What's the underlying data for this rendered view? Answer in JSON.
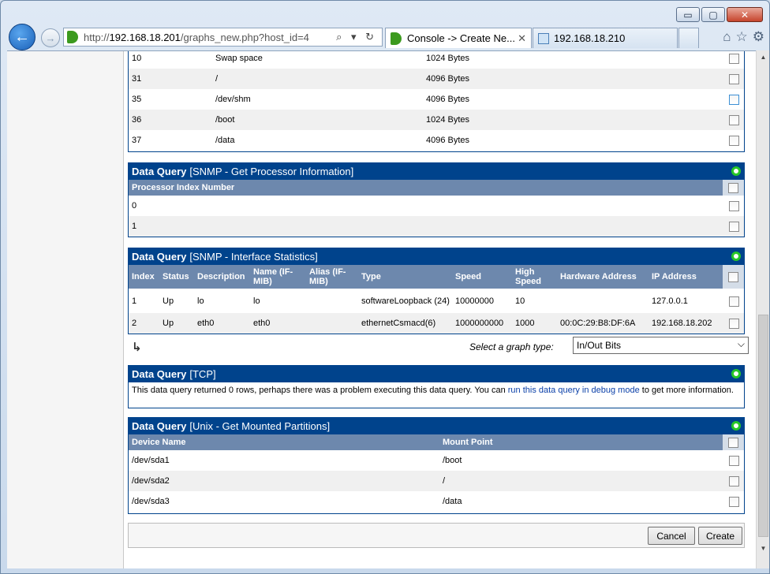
{
  "browser": {
    "url_prefix": "http://",
    "url_host": "192.168.18.201",
    "url_path": "/graphs_new.php?host_id=4",
    "addr_icons": "⌕ ▾ ↻",
    "tabs": [
      {
        "label": "Console -> Create Ne...",
        "close": "✕"
      },
      {
        "label": "192.168.18.210"
      }
    ],
    "controls": {
      "minimize": "▭",
      "maximize": "▢",
      "close": "✕"
    },
    "tool_icons": {
      "home": "⌂",
      "favorites": "☆",
      "settings": "⚙"
    }
  },
  "top_rows": [
    {
      "index": "10",
      "name": "Swap space",
      "size": "1024 Bytes"
    },
    {
      "index": "31",
      "name": "/",
      "size": "4096 Bytes"
    },
    {
      "index": "35",
      "name": "/dev/shm",
      "size": "4096 Bytes"
    },
    {
      "index": "36",
      "name": "/boot",
      "size": "1024 Bytes"
    },
    {
      "index": "37",
      "name": "/data",
      "size": "4096 Bytes"
    }
  ],
  "processor": {
    "title_bold": "Data Query",
    "title": "[SNMP - Get Processor Information]",
    "column": "Processor Index Number",
    "rows": [
      "0",
      "1"
    ]
  },
  "interfaces": {
    "title_bold": "Data Query",
    "title": "[SNMP - Interface Statistics]",
    "columns": {
      "index": "Index",
      "status": "Status",
      "description": "Description",
      "name": "Name (IF-MIB)",
      "alias": "Alias (IF-MIB)",
      "type": "Type",
      "speed": "Speed",
      "high_speed": "High Speed",
      "hardware": "Hardware Address",
      "ip": "IP Address"
    },
    "rows": [
      {
        "index": "1",
        "status": "Up",
        "description": "lo",
        "name": "lo",
        "type": "softwareLoopback (24)",
        "speed": "10000000",
        "high_speed": "10",
        "hardware": "",
        "ip": "127.0.0.1"
      },
      {
        "index": "2",
        "status": "Up",
        "description": "eth0",
        "name": "eth0",
        "type": "ethernetCsmacd(6)",
        "speed": "1000000000",
        "high_speed": "1000",
        "hardware": "00:0C:29:B8:DF:6A",
        "ip": "192.168.18.202"
      }
    ],
    "graph_type_label": "Select a graph type:",
    "graph_type_value": "In/Out Bits",
    "return_icon": "↳"
  },
  "tcp": {
    "title_bold": "Data Query",
    "title": "[TCP]",
    "message_before": "This data query returned 0 rows, perhaps there was a problem executing this data query. You can ",
    "message_link": "run this data query in debug mode",
    "message_after": " to get more information."
  },
  "partitions": {
    "title_bold": "Data Query",
    "title": "[Unix - Get Mounted Partitions]",
    "columns": {
      "device": "Device Name",
      "mount": "Mount Point"
    },
    "rows": [
      {
        "device": "/dev/sda1",
        "mount": "/boot"
      },
      {
        "device": "/dev/sda2",
        "mount": "/"
      },
      {
        "device": "/dev/sda3",
        "mount": "/data"
      }
    ]
  },
  "buttons": {
    "cancel": "Cancel",
    "create": "Create"
  },
  "scroll_arrows": {
    "up": "▲",
    "down": "▼"
  }
}
